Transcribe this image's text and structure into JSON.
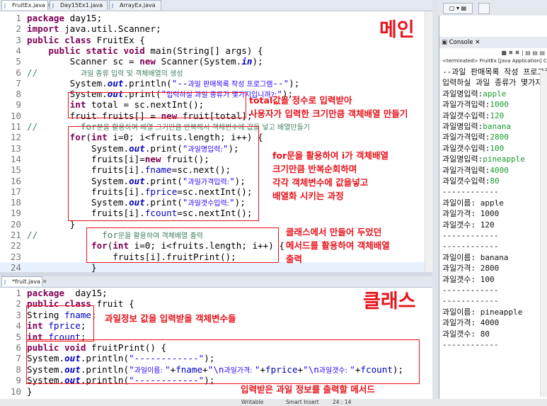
{
  "top_tabs": [
    "FruitEx.java",
    "Day15Ex1.java",
    "ArrayEx.java"
  ],
  "top_lines": [
    {
      "n": "1",
      "c": [
        [
          "kw",
          "package"
        ],
        [
          "",
          "day15;"
        ]
      ]
    },
    {
      "n": "2",
      "c": [
        [
          "kw",
          "import"
        ],
        [
          "",
          "java.util.Scanner;"
        ]
      ]
    },
    {
      "n": "3",
      "c": [
        [
          "kw",
          "public class"
        ],
        [
          "",
          " FruitEx {"
        ]
      ]
    },
    {
      "n": "4",
      "c": [
        [
          "",
          "    "
        ],
        [
          "kw",
          "public static void"
        ],
        [
          "",
          " main(String[] args) {"
        ]
      ]
    },
    {
      "n": "5",
      "c": [
        [
          "",
          "        Scanner sc = "
        ],
        [
          "kw",
          "new"
        ],
        [
          "",
          " Scanner(System."
        ],
        [
          "it",
          "in"
        ],
        [
          "",
          ");"
        ]
      ]
    },
    {
      "n": "6",
      "c": [
        [
          "cm",
          "//        "
        ],
        [
          "cm sm",
          "과일 종류 입력 및 객체배열의 생성"
        ]
      ]
    },
    {
      "n": "7",
      "c": [
        [
          "",
          "        System."
        ],
        [
          "it",
          "out"
        ],
        [
          "",
          ".println("
        ],
        [
          "st",
          "\"--"
        ],
        [
          "st sm",
          "과일 판매목록 작성 프로그램"
        ],
        [
          "st",
          "--\""
        ],
        [
          "",
          ");"
        ]
      ]
    },
    {
      "n": "8",
      "c": [
        [
          "",
          "        System."
        ],
        [
          "it",
          "out"
        ],
        [
          "",
          ".print("
        ],
        [
          "st",
          "\""
        ],
        [
          "st sm",
          "입력하실 과일 종류가 몇가지입니까?:"
        ],
        [
          "st",
          "\""
        ],
        [
          "",
          ");"
        ]
      ]
    },
    {
      "n": "9",
      "c": [
        [
          "",
          "        "
        ],
        [
          "kw",
          "int"
        ],
        [
          "",
          " total = sc.nextInt();"
        ]
      ]
    },
    {
      "n": "10",
      "c": [
        [
          "",
          "        fruit fruits[] = "
        ],
        [
          "kw",
          "new"
        ],
        [
          "",
          " fruit[total];"
        ]
      ]
    },
    {
      "n": "11",
      "c": [
        [
          "cm",
          "//        for"
        ],
        [
          "cm sm",
          "문을 활용하여 배열 크기만큼 반복해서 객체변수에 값을 넣고 배열만들기"
        ]
      ]
    },
    {
      "n": "12",
      "c": [
        [
          "",
          "        "
        ],
        [
          "kw",
          "for"
        ],
        [
          "",
          "("
        ],
        [
          "kw",
          "int"
        ],
        [
          "",
          " i=0; i<fruits.length; i++) {"
        ]
      ]
    },
    {
      "n": "13",
      "c": [
        [
          "",
          "            System."
        ],
        [
          "it",
          "out"
        ],
        [
          "",
          ".print("
        ],
        [
          "st",
          "\""
        ],
        [
          "st sm",
          "과일명입력:"
        ],
        [
          "st",
          "\""
        ],
        [
          "",
          ");"
        ]
      ]
    },
    {
      "n": "14",
      "c": [
        [
          "",
          "            fruits[i]="
        ],
        [
          "kw",
          "new"
        ],
        [
          "",
          " fruit();"
        ]
      ]
    },
    {
      "n": "15",
      "c": [
        [
          "",
          "            fruits[i]."
        ],
        [
          "fd",
          "fname"
        ],
        [
          "",
          "=sc.next();"
        ]
      ]
    },
    {
      "n": "16",
      "c": [
        [
          "",
          "            System."
        ],
        [
          "it",
          "out"
        ],
        [
          "",
          ".print("
        ],
        [
          "st",
          "\""
        ],
        [
          "st sm",
          "과일가격입력:"
        ],
        [
          "st",
          "\""
        ],
        [
          "",
          ");"
        ]
      ]
    },
    {
      "n": "17",
      "c": [
        [
          "",
          "            fruits[i]."
        ],
        [
          "fd",
          "fprice"
        ],
        [
          "",
          "=sc.nextInt();"
        ]
      ]
    },
    {
      "n": "18",
      "c": [
        [
          "",
          "            System."
        ],
        [
          "it",
          "out"
        ],
        [
          "",
          ".print("
        ],
        [
          "st",
          "\""
        ],
        [
          "st sm",
          "과일갯수입력:"
        ],
        [
          "st",
          "\""
        ],
        [
          "",
          ");"
        ]
      ]
    },
    {
      "n": "19",
      "c": [
        [
          "",
          "            fruits[i]."
        ],
        [
          "fd",
          "fcount"
        ],
        [
          "",
          "=sc.nextInt();"
        ]
      ]
    },
    {
      "n": "20",
      "c": [
        [
          "",
          "        }"
        ]
      ]
    },
    {
      "n": "21",
      "c": [
        [
          "cm",
          "//            for"
        ],
        [
          "cm sm",
          "문을 활용하여 객체배열 출력"
        ]
      ]
    },
    {
      "n": "22",
      "c": [
        [
          "",
          "            "
        ],
        [
          "kw",
          "for"
        ],
        [
          "",
          "("
        ],
        [
          "kw",
          "int"
        ],
        [
          "",
          " i=0; i<fruits.length; i++) {"
        ]
      ]
    },
    {
      "n": "23",
      "c": [
        [
          "",
          "                fruits[i].fruitPrint();"
        ]
      ]
    },
    {
      "n": "24",
      "c": [
        [
          "",
          "            }"
        ]
      ]
    }
  ],
  "bottom_tab": "*fruit.java",
  "bottom_lines": [
    {
      "n": "1",
      "c": [
        [
          "kw",
          "package"
        ],
        [
          "",
          " day15;"
        ]
      ]
    },
    {
      "n": "2",
      "c": [
        [
          "kw",
          "public class"
        ],
        [
          "",
          " fruit {"
        ]
      ]
    },
    {
      "n": "3",
      "c": [
        [
          "",
          "String "
        ],
        [
          "fd",
          "fname"
        ],
        [
          "",
          ";"
        ]
      ]
    },
    {
      "n": "4",
      "c": [
        [
          "kw",
          "int"
        ],
        [
          "",
          " "
        ],
        [
          "fd",
          "fprice"
        ],
        [
          "",
          ";"
        ]
      ]
    },
    {
      "n": "5",
      "c": [
        [
          "kw",
          "int"
        ],
        [
          "",
          " "
        ],
        [
          "fd",
          "fcount"
        ],
        [
          "",
          ";"
        ]
      ]
    },
    {
      "n": "6",
      "c": [
        [
          "kw",
          "public void"
        ],
        [
          "",
          " fruitPrint() {"
        ]
      ]
    },
    {
      "n": "7",
      "c": [
        [
          "",
          "System."
        ],
        [
          "it",
          "out"
        ],
        [
          "",
          ".println("
        ],
        [
          "st",
          "\"------------\""
        ],
        [
          "",
          ");"
        ]
      ]
    },
    {
      "n": "8",
      "c": [
        [
          "",
          "System."
        ],
        [
          "it",
          "out"
        ],
        [
          "",
          ".println("
        ],
        [
          "st",
          "\""
        ],
        [
          "st sm",
          "과일이름: "
        ],
        [
          "st",
          "\""
        ],
        [
          "",
          "+"
        ],
        [
          "fd",
          "fname"
        ],
        [
          "",
          "+"
        ],
        [
          "st",
          "\"\\n"
        ],
        [
          "st sm",
          "과일가격: "
        ],
        [
          "st",
          "\""
        ],
        [
          "",
          "+"
        ],
        [
          "fd",
          "fprice"
        ],
        [
          "",
          "+"
        ],
        [
          "st",
          "\"\\n"
        ],
        [
          "st sm",
          "과일갯수: "
        ],
        [
          "st",
          "\""
        ],
        [
          "",
          "+"
        ],
        [
          "fd",
          "fcount"
        ],
        [
          "",
          ");"
        ]
      ]
    },
    {
      "n": "9",
      "c": [
        [
          "",
          "System."
        ],
        [
          "it",
          "out"
        ],
        [
          "",
          ".println("
        ],
        [
          "st",
          "\"------------\""
        ],
        [
          "",
          ");"
        ]
      ]
    },
    {
      "n": "10",
      "c": [
        [
          "",
          "}"
        ]
      ]
    }
  ],
  "annotations": {
    "main_title": "메인",
    "class_title": "클래스",
    "total_note": "total값을 정수로 입력받아\n사용자가 입력한 크기만큼 객체배열 만들기",
    "for_note": "for문을 활용하여 i가 객체배열\n크기만큼 반복순회하며\n각각 객체변수에 값을넣고\n배열화 시키는 과정",
    "print_note": "클래스에서 만들어 두었던\n메서드를 활용하여 객체배열\n출력",
    "fields_note": "과일정보 값을 입력받을 객체변수들",
    "method_note": "입력받은 과일 정보를 출력할 메서드"
  },
  "console": {
    "title": "Console",
    "terminated": "<terminated> FruitEx [Java Application] C:\\Pr",
    "lines": [
      {
        "t": "--과일 판매목록 작성 프로그램-"
      },
      {
        "t": "입력하실 과일 종류가 몇가지입니"
      },
      {
        "p": "과일명입력:",
        "v": "apple"
      },
      {
        "p": "과일가격입력:",
        "v": "1000"
      },
      {
        "p": "과일갯수입력:",
        "v": "120"
      },
      {
        "p": "과일명입력:",
        "v": "banana"
      },
      {
        "p": "과일가격입력:",
        "v": "2800"
      },
      {
        "p": "과일갯수입력:",
        "v": "100"
      },
      {
        "p": "과일명입력:",
        "v": "pineapple"
      },
      {
        "p": "과일가격입력:",
        "v": "4000"
      },
      {
        "p": "과일갯수입력:",
        "v": "80"
      },
      {
        "t": "------------"
      },
      {
        "t": "과일이름: apple"
      },
      {
        "t": "과일가격: 1000"
      },
      {
        "t": "과일갯수: 120"
      },
      {
        "t": "------------"
      },
      {
        "t": "------------"
      },
      {
        "t": "과일이름: banana"
      },
      {
        "t": "과일가격: 2800"
      },
      {
        "t": "과일갯수: 100"
      },
      {
        "t": "------------"
      },
      {
        "t": "------------"
      },
      {
        "t": "과일이름: pineapple"
      },
      {
        "t": "과일가격: 4000"
      },
      {
        "t": "과일갯수: 80"
      },
      {
        "t": "------------"
      }
    ]
  },
  "status": {
    "mode": "Writable",
    "insert": "Smart Insert",
    "position": "24 : 14"
  }
}
